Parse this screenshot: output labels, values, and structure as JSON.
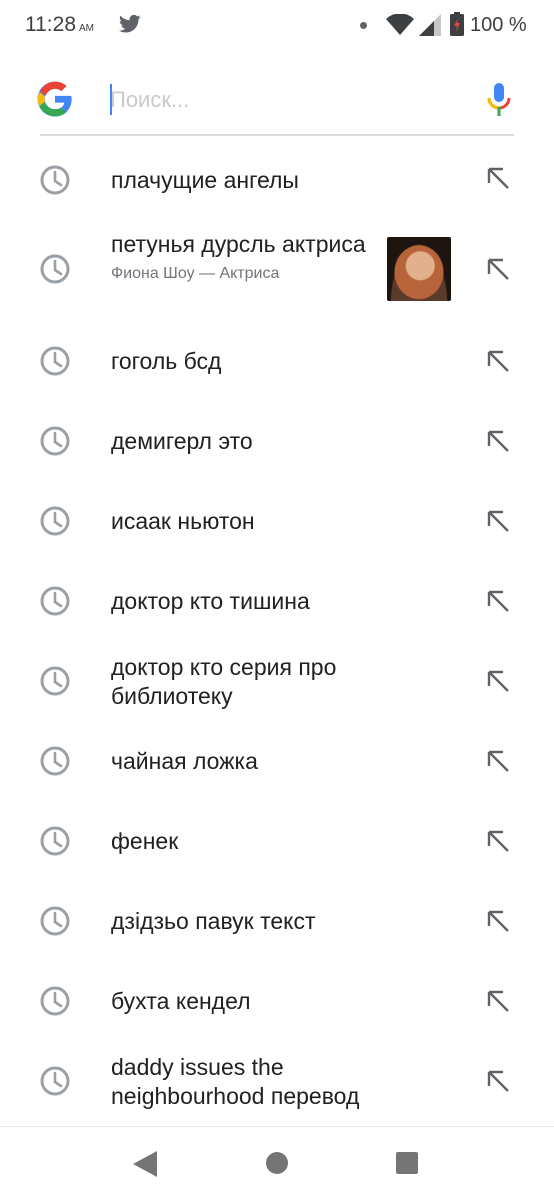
{
  "status_bar": {
    "time": "11:28",
    "ampm": "AM",
    "battery": "100 %",
    "icons": [
      "twitter-icon",
      "notification-dot-icon",
      "wifi-icon",
      "signal-icon",
      "battery-charging-icon"
    ]
  },
  "search": {
    "placeholder": "Поиск...",
    "value": "",
    "logo": "google-logo",
    "mic": "microphone-icon"
  },
  "history": [
    {
      "text": "плачущие ангелы"
    },
    {
      "text": "петунья дурсль актриса",
      "subtitle": "Фиона Шоу — Актриса",
      "thumbnail": "person-photo"
    },
    {
      "text": "гоголь бсд"
    },
    {
      "text": "демигерл это"
    },
    {
      "text": "исаак ньютон"
    },
    {
      "text": "доктор кто тишина"
    },
    {
      "text": "доктор кто серия про библиотеку"
    },
    {
      "text": "чайная ложка"
    },
    {
      "text": "фенек"
    },
    {
      "text": "дзідзьо павук текст"
    },
    {
      "text": "бухта кендел"
    },
    {
      "text": "daddy issues the neighbourhood перевод"
    }
  ],
  "nav_bar": {
    "icons": [
      "back-icon",
      "home-icon",
      "recents-icon"
    ]
  },
  "colors": {
    "google_blue": "#4285f4",
    "google_red": "#ea4335",
    "google_yellow": "#fbbc05",
    "google_green": "#34a853",
    "icon_gray": "#9aa0a6"
  }
}
